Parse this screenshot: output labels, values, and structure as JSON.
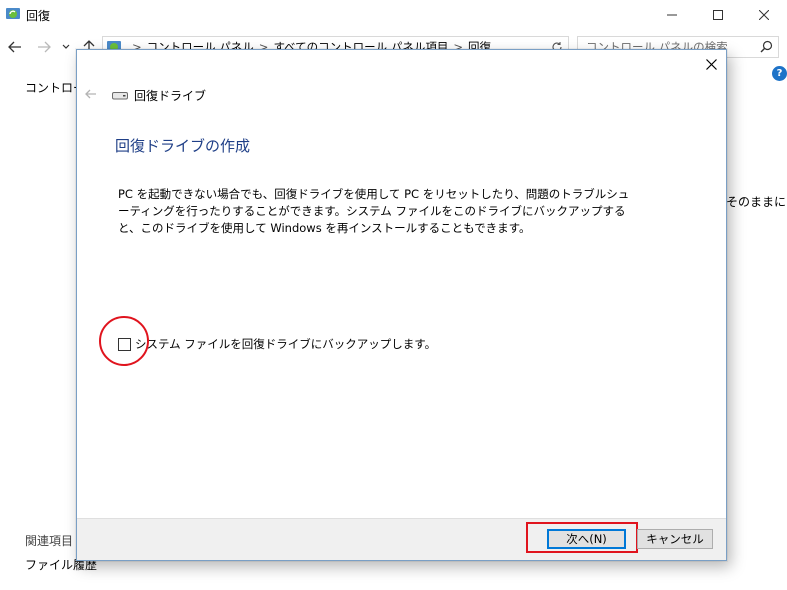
{
  "window": {
    "title": "回復",
    "minimize_icon": "minimize-icon",
    "maximize_icon": "maximize-icon",
    "close_icon": "close-icon"
  },
  "navigation": {
    "back_icon": "back-arrow-icon",
    "forward_icon": "forward-arrow-icon",
    "recent_icon": "chevron-down-icon",
    "up_icon": "up-arrow-icon",
    "breadcrumbs": [
      "コントロール パネル",
      "すべてのコントロール パネル項目",
      "回復"
    ],
    "breadcrumb_separator": ">",
    "refresh_icon": "refresh-icon",
    "search_placeholder": "コントロール パネルの検索"
  },
  "background": {
    "left_label": "コントロール",
    "right_text": "そのままにし",
    "related_heading": "関連項目",
    "file_history": "ファイル履歴"
  },
  "dialog": {
    "title": "回復ドライブ",
    "heading": "回復ドライブの作成",
    "description": "PC を起動できない場合でも、回復ドライブを使用して PC をリセットしたり、問題のトラブルシューティングを行ったりすることができます。システム ファイルをこのドライブにバックアップすると、このドライブを使用して Windows を再インストールすることもできます。",
    "checkbox_label": "システム ファイルを回復ドライブにバックアップします。",
    "checkbox_checked": false,
    "next_button": "次へ(N)",
    "cancel_button": "キャンセル"
  },
  "colors": {
    "heading_blue": "#1f3f87",
    "highlight_red": "#e0141e",
    "default_button_border": "#0078d7",
    "footer_bg": "#f0f0f0"
  }
}
